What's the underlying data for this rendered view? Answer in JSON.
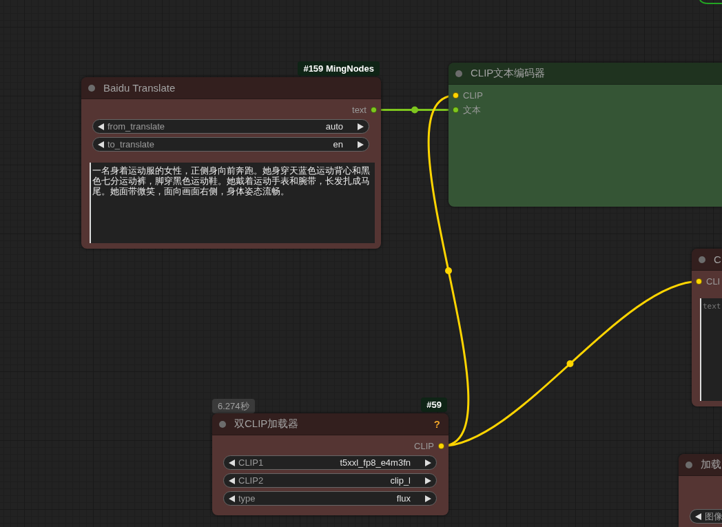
{
  "nodes": [
    {
      "title": "Baidu Translate",
      "color": "#553533",
      "badges": [
        {
          "kind": "id",
          "text": "#159 MingNodes"
        }
      ],
      "outputs": [
        {
          "label": "text",
          "color": "#7ec61e"
        }
      ],
      "widgets": [
        {
          "kind": "combo",
          "name": "from_translate",
          "value": "auto"
        },
        {
          "kind": "combo",
          "name": "to_translate",
          "value": "en"
        },
        {
          "kind": "textarea",
          "value": "一名身着运动服的女性，正侧身向前奔跑。她身穿天蓝色运动背心和黑色七分运动裤，脚穿黑色运动鞋。她戴着运动手表和腕带，长发扎成马尾。她面带微笑，面向画面右侧，身体姿态流畅。"
        }
      ]
    },
    {
      "title": "CLIP文本编码器",
      "color": "#355535",
      "inputs": [
        {
          "label": "CLIP",
          "color": "#ffd500"
        },
        {
          "label": "文本",
          "color": "#7ec61e"
        }
      ]
    },
    {
      "title": "C",
      "color": "#553533",
      "inputs": [
        {
          "label": "CLI",
          "color": "#ffd500"
        }
      ],
      "widgets": [
        {
          "kind": "textarea",
          "placeholder": "text"
        }
      ]
    },
    {
      "title": "双CLIP加载器",
      "color": "#553533",
      "help": "?",
      "badges": [
        {
          "kind": "time",
          "text": "6.274秒"
        },
        {
          "kind": "id",
          "text": "#59"
        }
      ],
      "outputs": [
        {
          "label": "CLIP",
          "color": "#ffd500"
        }
      ],
      "widgets": [
        {
          "kind": "combo",
          "name": "CLIP1",
          "value": "t5xxl_fp8_e4m3fn"
        },
        {
          "kind": "combo",
          "name": "CLIP2",
          "value": "clip_l"
        },
        {
          "kind": "combo",
          "name": "type",
          "value": "flux"
        }
      ]
    },
    {
      "title": "加载",
      "color": "#553533",
      "widgets": [
        {
          "kind": "combo",
          "name": "图像"
        }
      ]
    }
  ]
}
